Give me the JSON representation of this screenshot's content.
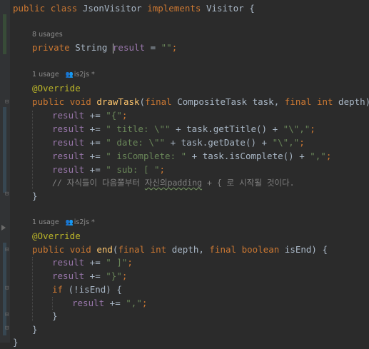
{
  "editor": {
    "class_decl": {
      "kw1": "public",
      "kw2": "class",
      "name": "JsonVisitor",
      "kw3": "implements",
      "iface": "Visitor",
      "brace": "{"
    },
    "field_hint": "8 usages",
    "field": {
      "kw": "private",
      "type": "String",
      "name": "result",
      "rest": " = ",
      "value": "\"\"",
      "end": ";"
    },
    "method1_hint": {
      "usage": "1 usage",
      "author": "is2js *"
    },
    "method1_annotation": "@Override",
    "method1_sig": {
      "kw1": "public",
      "kw2": "void",
      "name": "drawTask",
      "open": "(",
      "kw3": "final",
      "p1type": "CompositeTask task, ",
      "kw4": "final",
      "kw5": "int",
      "p2": "depth) {"
    },
    "method1_body": {
      "l1": {
        "fld": "result",
        "op": " += ",
        "str": "\"{\"",
        "end": ";"
      },
      "l2": {
        "fld": "result",
        "op": " += ",
        "str": "\" title: \\\"\"",
        "mid": " + task.getTitle() + ",
        "str2": "\"\\\",\"",
        "end": ";"
      },
      "l3": {
        "fld": "result",
        "op": " += ",
        "str": "\" date: \\\"\"",
        "mid": " + task.getDate() + ",
        "str2": "\"\\\",\"",
        "end": ";"
      },
      "l4": {
        "fld": "result",
        "op": " += ",
        "str": "\" isComplete: \"",
        "mid": " + task.isComplete() + ",
        "str2": "\",\"",
        "end": ";"
      },
      "l5": {
        "fld": "result",
        "op": " += ",
        "str": "\" sub: [ \"",
        "end": ";"
      },
      "comment": {
        "a": "// 자식들이 다음쭐부터 ",
        "typo": "자신의padding",
        "b": " + { 로 시작될 것이다."
      },
      "close": "}"
    },
    "method2_hint": {
      "usage": "1 usage",
      "author": "is2js *"
    },
    "method2_annotation": "@Override",
    "method2_sig": {
      "kw1": "public",
      "kw2": "void",
      "name": "end",
      "open": "(",
      "kw3": "final",
      "kw4": "int",
      "p1": " depth, ",
      "kw5": "final",
      "kw6": "boolean",
      "p2": " isEnd) {"
    },
    "method2_body": {
      "l1": {
        "fld": "result",
        "op": " += ",
        "str": "\" ]\"",
        "end": ";"
      },
      "l2": {
        "fld": "result",
        "op": " += ",
        "str": "\"}\"",
        "end": ";"
      },
      "if": {
        "kw": "if",
        "cond": " (!isEnd) {"
      },
      "inner": {
        "fld": "result",
        "op": " += ",
        "str": "\",\"",
        "end": ";"
      },
      "if_close": "}",
      "close": "}"
    },
    "class_close": "}"
  },
  "colors": {
    "background": "#2b2b2b",
    "keyword": "#cc7832",
    "field": "#9876aa",
    "method": "#ffc66d",
    "string": "#6a8759",
    "annotation": "#bbb529",
    "comment": "#808080"
  }
}
